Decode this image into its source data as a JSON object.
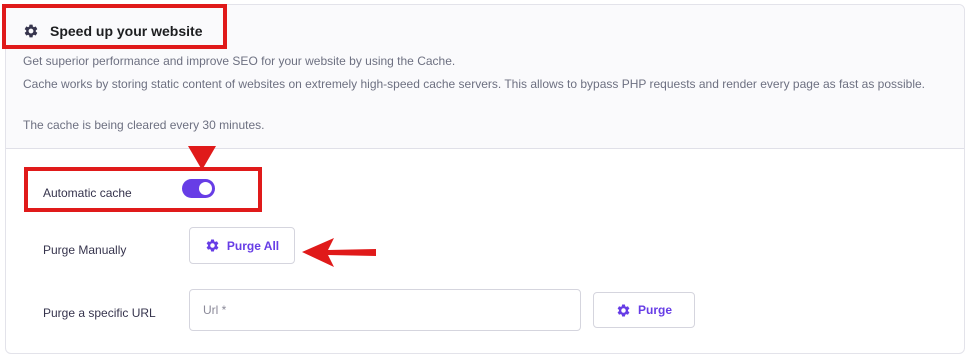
{
  "header": {
    "title": "Speed up your website",
    "description_line1": "Get superior performance and improve SEO for your website by using the Cache.",
    "description_line2": "Cache works by storing static content of websites on extremely high-speed cache servers. This allows to bypass PHP requests and render every page as fast as possible.",
    "description_line3": "The cache is being cleared every 30 minutes."
  },
  "automatic_cache": {
    "label": "Automatic cache",
    "enabled": true
  },
  "purge_manually": {
    "label": "Purge Manually",
    "button_label": "Purge All"
  },
  "purge_url": {
    "label": "Purge a specific URL",
    "placeholder": "Url *",
    "value": "",
    "button_label": "Purge"
  },
  "colors": {
    "accent": "#673de6",
    "annotation": "#e01a1a",
    "text": "#36344d",
    "muted_text": "#6d7081"
  },
  "icons": {
    "header_icon": "gear-icon",
    "purge_all_icon": "gear-icon",
    "purge_icon": "gear-icon"
  }
}
